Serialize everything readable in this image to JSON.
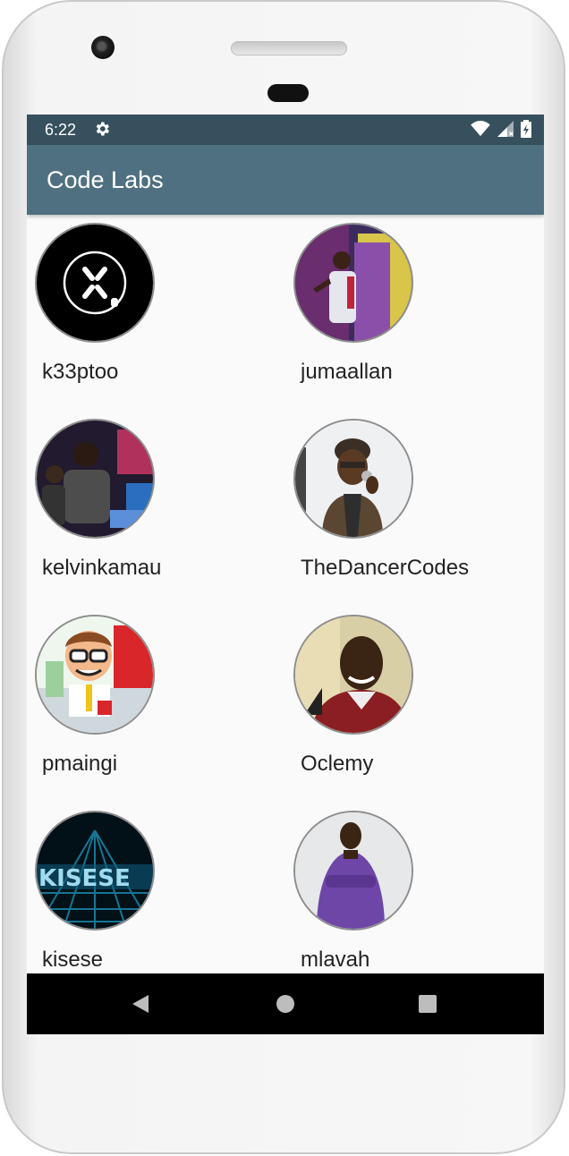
{
  "status_bar": {
    "time": "6:22"
  },
  "app_bar": {
    "title": "Code Labs"
  },
  "users": [
    {
      "name": "k33ptoo"
    },
    {
      "name": "jumaallan"
    },
    {
      "name": "kelvinkamau"
    },
    {
      "name": "TheDancerCodes"
    },
    {
      "name": "pmaingi"
    },
    {
      "name": "Oclemy"
    },
    {
      "name": "kisese"
    },
    {
      "name": "mlavah"
    }
  ],
  "colors": {
    "status_bar": "#37505e",
    "app_bar": "#4f7080",
    "background": "#fafafa"
  },
  "icons": [
    "gear-icon",
    "wifi-icon",
    "cell-signal-icon",
    "battery-charging-icon",
    "back-icon",
    "home-icon",
    "recents-icon"
  ]
}
